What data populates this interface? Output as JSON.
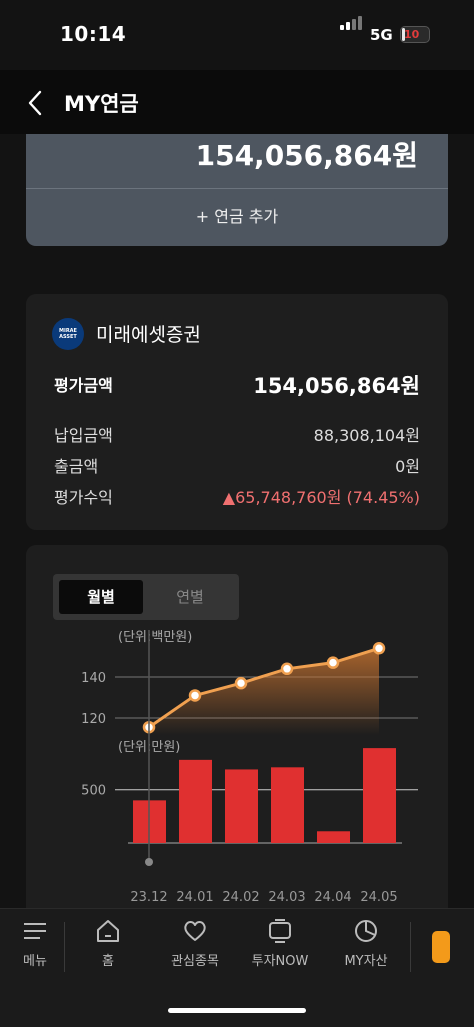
{
  "status": {
    "time": "10:14",
    "network": "5G",
    "battery": "10",
    "battery_level": 0.1
  },
  "header": {
    "title": "MY연금"
  },
  "summary": {
    "total": "154,056,864원",
    "add_label": "+ 연금 추가"
  },
  "account": {
    "logo_text": "MIRAE ASSET",
    "name": "미래에셋증권",
    "eval_label": "평가금액",
    "eval_value": "154,056,864원",
    "rows": [
      {
        "label": "납입금액",
        "value": "88,308,104원"
      },
      {
        "label": "출금액",
        "value": "0원"
      },
      {
        "label": "평가수익",
        "value": "▲65,748,760원 (74.45%)"
      }
    ],
    "profit_color": "#f07070"
  },
  "tabs": {
    "monthly": "월별",
    "yearly": "연별",
    "active": "월별"
  },
  "chart_data": [
    {
      "type": "area",
      "unit_label": "(단위:백만원)",
      "x": [
        "23.12",
        "24.01",
        "24.02",
        "24.03",
        "24.04",
        "24.05"
      ],
      "values": [
        115.5,
        131,
        137,
        144,
        147,
        154
      ],
      "yticks": [
        120,
        140
      ],
      "ylim": [
        110,
        160
      ],
      "color": "#f0a050"
    },
    {
      "type": "bar",
      "unit_label": "(단위:만원)",
      "x": [
        "23.12",
        "24.01",
        "24.02",
        "24.03",
        "24.04",
        "24.05"
      ],
      "values": [
        400,
        780,
        690,
        710,
        110,
        890
      ],
      "yticks": [
        500
      ],
      "ylim": [
        0,
        1000
      ],
      "color": "#e03030"
    }
  ],
  "nav": [
    {
      "label": "메뉴",
      "icon": "menu-icon"
    },
    {
      "label": "홈",
      "icon": "home-icon"
    },
    {
      "label": "관심종목",
      "icon": "heart-icon"
    },
    {
      "label": "투자NOW",
      "icon": "tv-icon"
    },
    {
      "label": "MY자산",
      "icon": "pie-chart-icon"
    }
  ]
}
